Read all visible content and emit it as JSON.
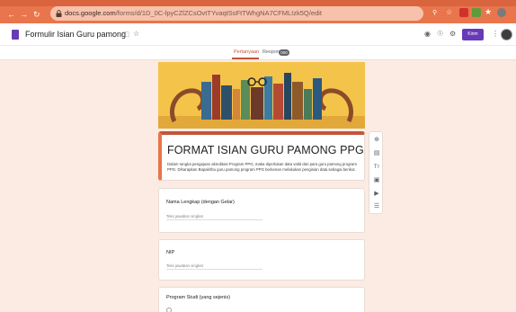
{
  "browser": {
    "url_host": "docs.google.com",
    "url_path": "/forms/d/1D_0C-lpyCZlZCsOvtTYvaqtSsFtTWhgNA7CFMLIzk5Q/edit"
  },
  "header": {
    "title": "Formulir Isian Guru pamong",
    "send_label": "Kirim"
  },
  "tabs": {
    "questions": "Pertanyaan",
    "responses": "Respons",
    "responses_count": "000"
  },
  "form": {
    "title": "FORMAT ISIAN GURU PAMONG PPG",
    "description": "Dalam rangka pengajuan akreditasi Program PPG, maka diperlukan data valid dari para guru pamong program PPG. Diharapkan Bapak/Ibu guru pamong program PPG berkenan melakukan pengisian data sebagai berikut."
  },
  "questions": [
    {
      "label": "Nama Lengkap (dengan Gelar)",
      "placeholder": "Teks jawaban singkat"
    },
    {
      "label": "NIP",
      "placeholder": "Teks jawaban singkat"
    },
    {
      "label": "Program Studi (yang sejenis)",
      "placeholder": ""
    }
  ],
  "colors": {
    "theme": "#c4553d",
    "background": "#fbebe2",
    "browser_bar": "#e9754c"
  }
}
